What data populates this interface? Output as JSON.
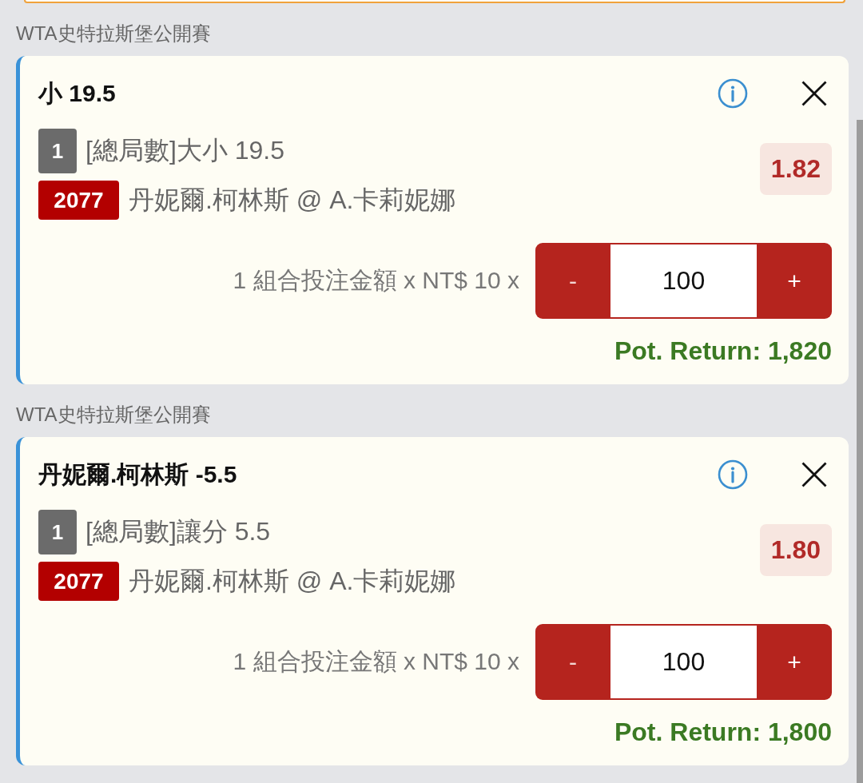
{
  "bet_slip": [
    {
      "league": "WTA史特拉斯堡公開賽",
      "selection": "小 19.5",
      "leg_number": "1",
      "market": "[總局數]大小 19.5",
      "event_code": "2077",
      "event": "丹妮爾.柯林斯 @ A.卡莉妮娜",
      "odds": "1.82",
      "stake_label": "1 組合投注金額 x NT$ 10 x",
      "stepper": {
        "decrease": "-",
        "amount": "100",
        "increase": "+"
      },
      "potential_return": "Pot. Return: 1,820"
    },
    {
      "league": "WTA史特拉斯堡公開賽",
      "selection": "丹妮爾.柯林斯 -5.5",
      "leg_number": "1",
      "market": "[總局數]讓分 5.5",
      "event_code": "2077",
      "event": "丹妮爾.柯林斯 @ A.卡莉妮娜",
      "odds": "1.80",
      "stake_label": "1 組合投注金額 x NT$ 10 x",
      "stepper": {
        "decrease": "-",
        "amount": "100",
        "increase": "+"
      },
      "potential_return": "Pot. Return: 1,800"
    }
  ]
}
